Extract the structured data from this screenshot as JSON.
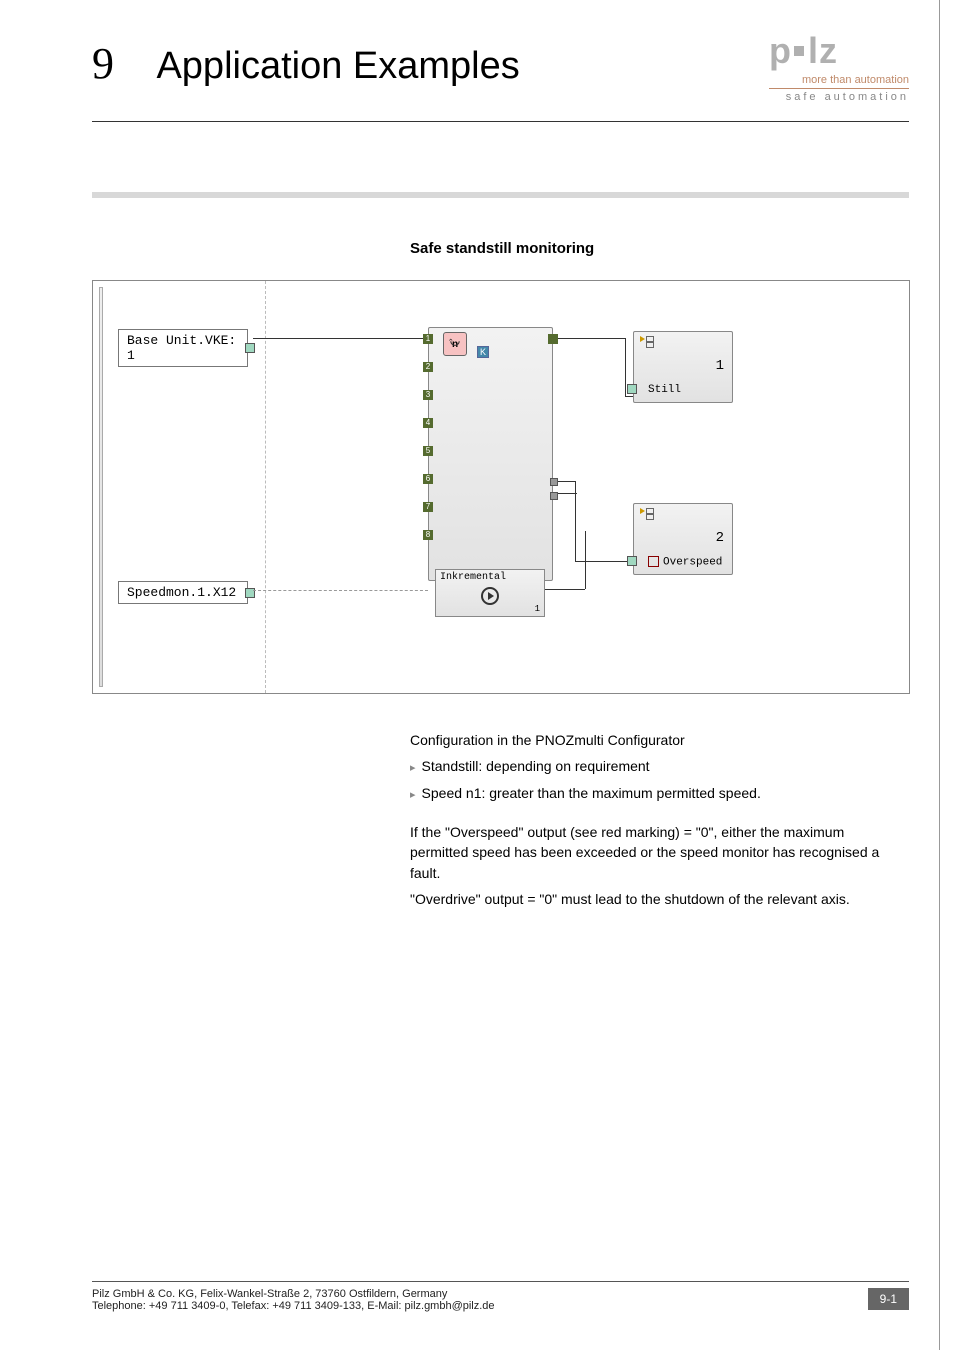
{
  "header": {
    "chapter_number": "9",
    "title": "Application Examples",
    "logo_text": "pilz",
    "tagline1": "more than automation",
    "tagline2": "safe automation"
  },
  "section_title": "Safe standstill monitoring",
  "diagram": {
    "port1_label": "Base Unit.VKE: 1",
    "port2_label": "Speedmon.1.X12",
    "speed_block": {
      "icon_letter": "n",
      "icon_marker": "K",
      "left_pins": [
        "1",
        "2",
        "3",
        "4",
        "5",
        "6",
        "7",
        "8"
      ]
    },
    "ink_block": {
      "label": "Inkremental",
      "corner": "1"
    },
    "out1": {
      "number": "1",
      "label": "Still"
    },
    "out2": {
      "number": "2",
      "label": "Overspeed"
    }
  },
  "body": {
    "p_intro": "Configuration in the PNOZmulti Configurator",
    "b1": "Standstill: depending on requirement",
    "b2": "Speed n1: greater than the maximum permitted speed.",
    "p2": "If the \"Overspeed\" output (see red marking) = \"0\", either the maximum permitted speed has been exceeded or the speed monitor has recognised a fault.",
    "p3": "\"Overdrive\" output = \"0\" must lead to the shutdown of the relevant axis."
  },
  "footer": {
    "line1": "Pilz GmbH & Co. KG, Felix-Wankel-Straße 2, 73760 Ostfildern, Germany",
    "line2": "Telephone: +49 711 3409-0, Telefax: +49 711 3409-133, E-Mail: pilz.gmbh@pilz.de",
    "pagenum": "9-1"
  }
}
